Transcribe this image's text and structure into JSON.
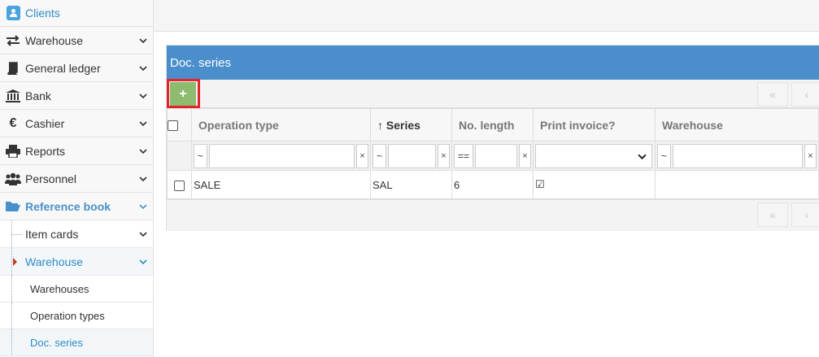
{
  "sidebar": {
    "items": [
      {
        "label": "Clients",
        "icon": "user-icon"
      },
      {
        "label": "Warehouse",
        "icon": "exchange-icon"
      },
      {
        "label": "General ledger",
        "icon": "book-icon"
      },
      {
        "label": "Bank",
        "icon": "bank-icon"
      },
      {
        "label": "Cashier",
        "icon": "euro-icon"
      },
      {
        "label": "Reports",
        "icon": "printer-icon"
      },
      {
        "label": "Personnel",
        "icon": "users-icon"
      },
      {
        "label": "Reference book",
        "icon": "folder-open-icon"
      }
    ],
    "subitems": [
      {
        "label": "Item cards"
      },
      {
        "label": "Warehouse"
      }
    ],
    "leaves": [
      {
        "label": "Warehouses"
      },
      {
        "label": "Operation types"
      },
      {
        "label": "Doc. series"
      }
    ]
  },
  "panel": {
    "title": "Doc. series",
    "add_label": "+",
    "first_page": "«",
    "prev_page": "‹",
    "columns": [
      "Operation type",
      "Series",
      "No. length",
      "Print invoice?",
      "Warehouse"
    ],
    "sort_indicator": "↑",
    "filters": {
      "op_type": "~",
      "series": "~",
      "length": "==",
      "warehouse": "~",
      "clear": "×"
    },
    "rows": [
      {
        "operation_type": "SALE",
        "series": "SAL",
        "length": "6",
        "print_invoice": "☑",
        "warehouse": ""
      }
    ]
  },
  "colors": {
    "header": "#4a8ecb",
    "add_button": "#8dbc6e",
    "highlight": "#e0262b",
    "accent": "#2e8bc9"
  }
}
